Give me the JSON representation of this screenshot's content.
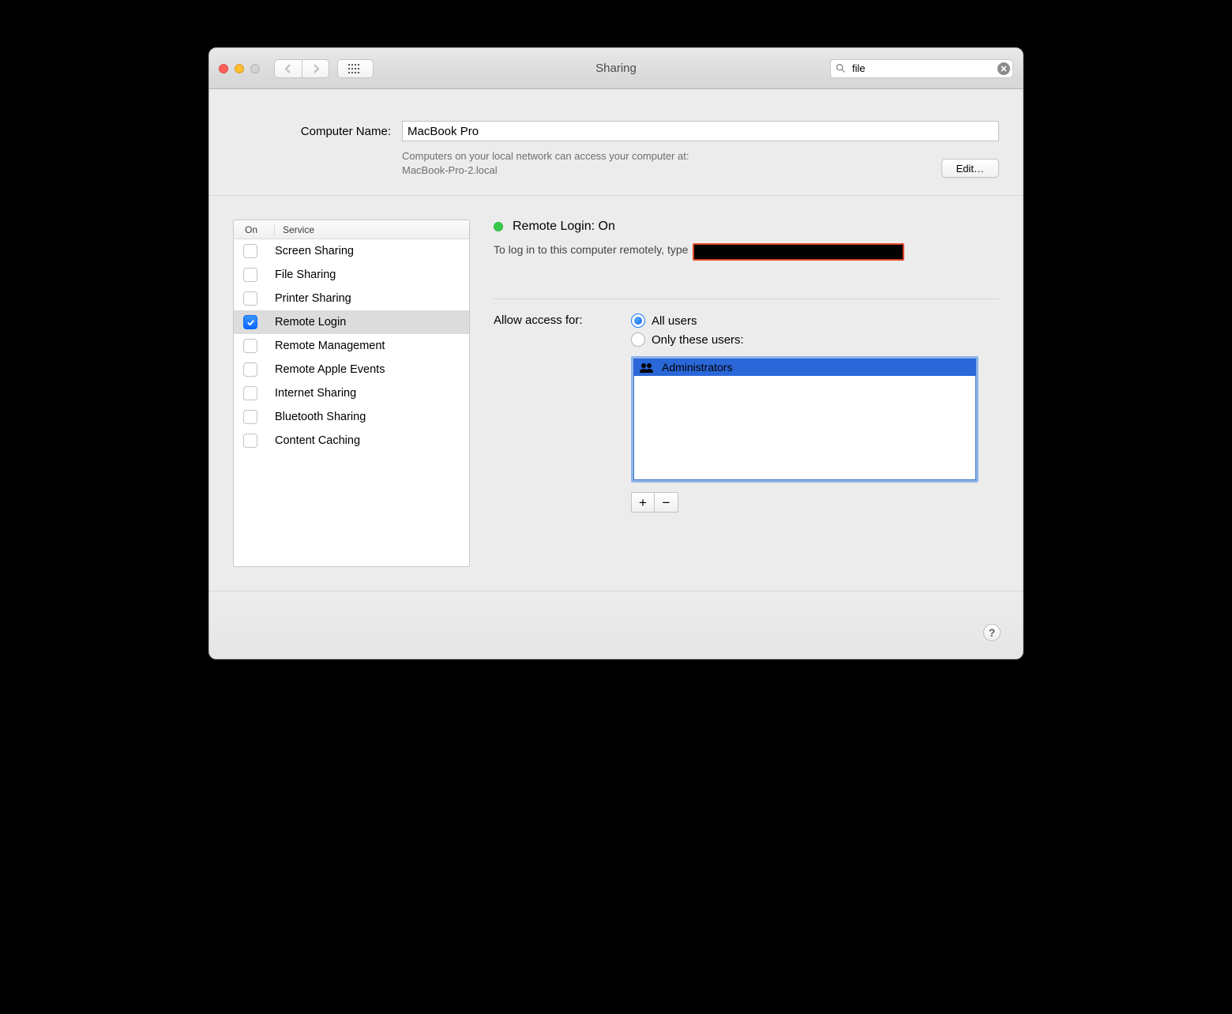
{
  "window": {
    "title": "Sharing"
  },
  "toolbar": {
    "search_value": "file"
  },
  "name_section": {
    "label": "Computer Name:",
    "value": "MacBook Pro",
    "description_l1": "Computers on your local network can access your computer at:",
    "description_l2": "MacBook-Pro-2.local",
    "edit_label": "Edit…"
  },
  "service_list": {
    "col_on": "On",
    "col_service": "Service",
    "items": [
      {
        "label": "Screen Sharing",
        "checked": false
      },
      {
        "label": "File Sharing",
        "checked": false
      },
      {
        "label": "Printer Sharing",
        "checked": false
      },
      {
        "label": "Remote Login",
        "checked": true
      },
      {
        "label": "Remote Management",
        "checked": false
      },
      {
        "label": "Remote Apple Events",
        "checked": false
      },
      {
        "label": "Internet Sharing",
        "checked": false
      },
      {
        "label": "Bluetooth Sharing",
        "checked": false
      },
      {
        "label": "Content Caching",
        "checked": false
      }
    ],
    "selected_index": 3
  },
  "detail": {
    "status_title": "Remote Login: On",
    "hint_prefix": "To log in to this computer remotely, type",
    "access_label": "Allow access for:",
    "radio_all": "All users",
    "radio_only": "Only these users:",
    "radio_selected": "all",
    "users": [
      "Administrators"
    ]
  }
}
